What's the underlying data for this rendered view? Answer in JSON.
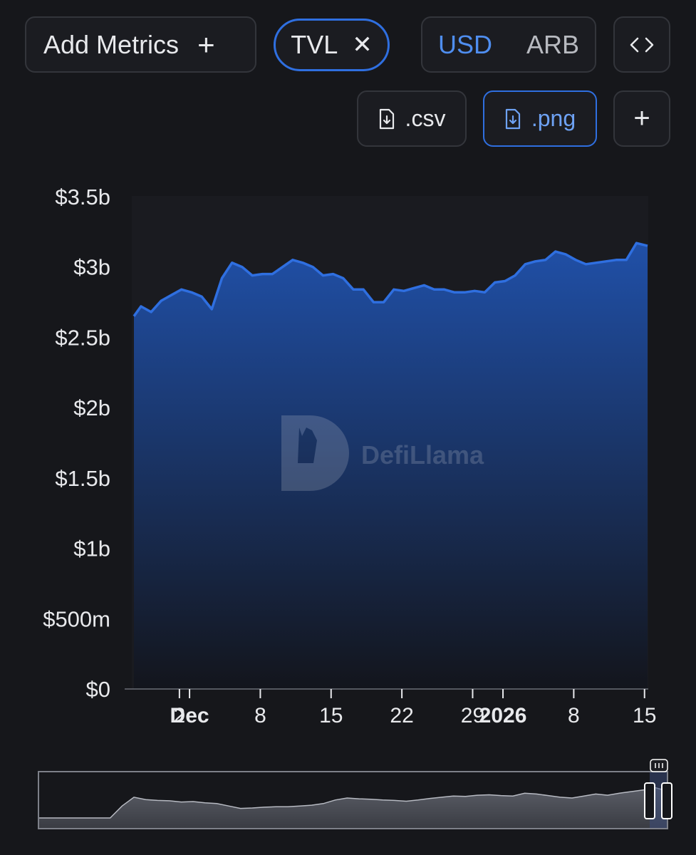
{
  "controls": {
    "add_metrics_label": "Add Metrics",
    "add_icon": "plus-icon",
    "active_metric": "TVL",
    "remove_icon": "close-icon",
    "currency_options": [
      "USD",
      "ARB"
    ],
    "currency_selected": "USD",
    "embed_icon": "code-brackets-icon",
    "download_csv_label": ".csv",
    "download_png_label": ".png",
    "download_icon": "file-download-icon",
    "more_icon": "plus-icon"
  },
  "watermark": "DefiLlama",
  "colors": {
    "background": "#16171b",
    "accent": "#2f6fe0",
    "line": "#2f6fe0",
    "area_top": "#2050a8",
    "area_bottom": "#13151c"
  },
  "chart_data": {
    "type": "area",
    "y_tick_labels": [
      "$0",
      "$500m",
      "$1b",
      "$1.5b",
      "$2b",
      "$2.5b",
      "$3b",
      "$3.5b"
    ],
    "y_ticks": [
      0,
      0.5,
      1,
      1.5,
      2,
      2.5,
      3,
      3.5
    ],
    "ylim": [
      0,
      3.5
    ],
    "y_unit": "billions USD",
    "x_ticks": [
      {
        "label": "2",
        "day": -27,
        "bold": false
      },
      {
        "label": "Dec",
        "day": -26,
        "bold": true
      },
      {
        "label": "8",
        "day": -19,
        "bold": false
      },
      {
        "label": "15",
        "day": -12,
        "bold": false
      },
      {
        "label": "22",
        "day": -5,
        "bold": false
      },
      {
        "label": "29",
        "day": 2,
        "bold": false
      },
      {
        "label": "2026",
        "day": 5,
        "bold": true
      },
      {
        "label": "8",
        "day": 12,
        "bold": false
      },
      {
        "label": "15",
        "day": 19,
        "bold": false
      }
    ],
    "x_day_range": [
      -31.5,
      19.3
    ],
    "series": [
      {
        "points": [
          [
            -31.5,
            2.65
          ],
          [
            -30.8,
            2.72
          ],
          [
            -29.8,
            2.68
          ],
          [
            -28.8,
            2.76
          ],
          [
            -27.8,
            2.8
          ],
          [
            -26.8,
            2.84
          ],
          [
            -25.8,
            2.82
          ],
          [
            -24.8,
            2.79
          ],
          [
            -23.8,
            2.7
          ],
          [
            -22.8,
            2.92
          ],
          [
            -21.8,
            3.03
          ],
          [
            -20.8,
            3.0
          ],
          [
            -19.8,
            2.94
          ],
          [
            -18.8,
            2.95
          ],
          [
            -17.8,
            2.95
          ],
          [
            -16.8,
            3.0
          ],
          [
            -15.8,
            3.05
          ],
          [
            -14.8,
            3.03
          ],
          [
            -13.8,
            3.0
          ],
          [
            -12.8,
            2.94
          ],
          [
            -11.8,
            2.95
          ],
          [
            -10.8,
            2.92
          ],
          [
            -9.8,
            2.84
          ],
          [
            -8.8,
            2.84
          ],
          [
            -7.8,
            2.75
          ],
          [
            -6.8,
            2.75
          ],
          [
            -5.8,
            2.84
          ],
          [
            -4.8,
            2.83
          ],
          [
            -3.8,
            2.85
          ],
          [
            -2.8,
            2.87
          ],
          [
            -1.8,
            2.84
          ],
          [
            -0.8,
            2.84
          ],
          [
            0.2,
            2.82
          ],
          [
            1.2,
            2.82
          ],
          [
            2.2,
            2.83
          ],
          [
            3.2,
            2.82
          ],
          [
            4.2,
            2.89
          ],
          [
            5.2,
            2.9
          ],
          [
            6.2,
            2.94
          ],
          [
            7.2,
            3.02
          ],
          [
            8.2,
            3.04
          ],
          [
            9.2,
            3.05
          ],
          [
            10.2,
            3.11
          ],
          [
            11.2,
            3.09
          ],
          [
            12.2,
            3.05
          ],
          [
            13.2,
            3.02
          ],
          [
            14.2,
            3.03
          ],
          [
            15.2,
            3.04
          ],
          [
            16.2,
            3.05
          ],
          [
            17.2,
            3.05
          ],
          [
            18.2,
            3.17
          ],
          [
            19.3,
            3.15
          ]
        ]
      }
    ],
    "grid": false,
    "legend": "none",
    "brush": {
      "overview": [
        0.0,
        0.0,
        0.0,
        0.0,
        0.0,
        0.0,
        0.0,
        0.3,
        0.52,
        0.46,
        0.44,
        0.43,
        0.4,
        0.41,
        0.38,
        0.36,
        0.3,
        0.24,
        0.25,
        0.27,
        0.28,
        0.28,
        0.3,
        0.32,
        0.36,
        0.45,
        0.5,
        0.48,
        0.47,
        0.45,
        0.44,
        0.42,
        0.45,
        0.49,
        0.52,
        0.55,
        0.54,
        0.57,
        0.58,
        0.56,
        0.55,
        0.62,
        0.6,
        0.56,
        0.52,
        0.5,
        0.55,
        0.6,
        0.57,
        0.62,
        0.66,
        0.7,
        0.76,
        0.68
      ],
      "selection_start": 0.96,
      "selection_end": 1.0
    }
  }
}
